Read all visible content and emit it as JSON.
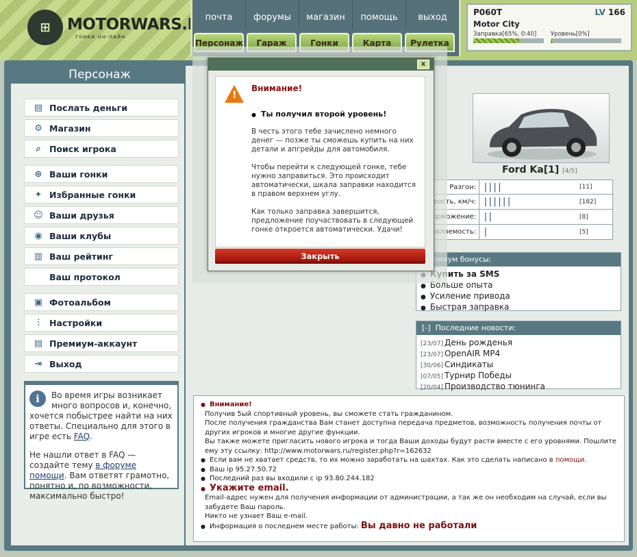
{
  "logo": {
    "name": "MOTORWARS.RU",
    "tagline": "гонки он-лайн"
  },
  "topnav": {
    "row1": [
      "почта",
      "форумы",
      "магазин",
      "помощь",
      "выход"
    ],
    "row2": [
      "Персонаж",
      "Гараж",
      "Гонки",
      "Карта",
      "Рулетка"
    ]
  },
  "status": {
    "nick": "P060T",
    "lv_label": "LV",
    "level": "166",
    "city": "Motor City",
    "fuel_label": "Заправка[65%, 0:40]",
    "fuel_pct": 65,
    "level_label": "Уровень[0%]",
    "level_pct": 0
  },
  "sidebar": {
    "title": "Персонаж",
    "group1": [
      "Послать деньги",
      "Магазин",
      "Поиск игрока"
    ],
    "group2": [
      "Ваши гонки",
      "Избранные гонки",
      "Ваши друзья",
      "Ваши клубы",
      "Ваш рейтинг",
      "Ваш протокол"
    ],
    "group3": [
      "Фотоальбом",
      "Настройки",
      "Премиум-аккаунт",
      "Выход"
    ],
    "faq_p1": "Во время игры возникает много вопросов и, конечно, хочется побыстрее найти на них ответы. Специально для этого в игре есть",
    "faq_link1": "FAQ",
    "faq_p2a": "Не нашли ответ в FAQ — создайте тему",
    "faq_link2": "в форуме помощи",
    "faq_p2b": ". Вам ответят грамотно, понятно и, по возможности, максимально быстро!"
  },
  "car": {
    "name": "Ford Ka[1]",
    "slots": "[4/5]",
    "stats": [
      {
        "label": "Разгон:",
        "bars": "||||",
        "value": "[11]"
      },
      {
        "label": "Скорость, км/ч:",
        "bars": "||||||",
        "value": "[182]"
      },
      {
        "label": "Торможение:",
        "bars": "||",
        "value": "[8]"
      },
      {
        "label": "Управляемость:",
        "bars": "|",
        "value": "[5]"
      }
    ]
  },
  "premium": {
    "header": "Премиум бонусы:",
    "items": [
      "Купить за SMS",
      "Больше опыта",
      "Усиление привода",
      "Быстрая заправка"
    ]
  },
  "news": {
    "toggle": "[-]",
    "header": "Последние новости:",
    "items": [
      {
        "date": "[23/07]",
        "title": "День рожденья"
      },
      {
        "date": "[23/07]",
        "title": "OpenAIR MP4"
      },
      {
        "date": "[30/06]",
        "title": "Синдикаты"
      },
      {
        "date": "[07/05]",
        "title": "Турнир Победы"
      },
      {
        "date": "[20/04]",
        "title": "Производство тюнинга"
      }
    ]
  },
  "info": {
    "warn_title": "Внимание!",
    "line1": "Получив 5ый спортивный уровень, вы сможете стать гражданином.",
    "line2": "После получения гражданства Вам станет доступна передача предметов, возможность получения почты от других игроков и многие другие функции.",
    "line3": "Вы также можете пригласить нового игрока и тогда Ваши доходы будут расти вместе с его уровнями. Пошлите ему эту ссылку: http://www.motorwars.ru/register.php?r=162632",
    "line4a": "Если вам не хватает средств, то их можно заработать на шахтах. Как это сделать написано в",
    "line4_link": "помощи",
    "line5": "Ваш ip 95.27.50.72",
    "line6": "Последний раз вы входили с ip 93.80.244.182",
    "email_title": "Укажите email.",
    "line7": "Email-адрес нужен для получения информации от администрации, а так же он необходим на случай, если вы забудете Ваш пароль.",
    "line8": "Никто не узнает Ваш e-mail.",
    "line9a": "Информация о последнем месте работы:",
    "line9b": "Вы давно не работали"
  },
  "modal": {
    "close_x": "x",
    "title": "Внимание!",
    "subtitle": "Ты получил второй уровень!",
    "p1": "В честь этого тебе зачислено немного денег — позже ты сможешь купить на них детали и апгрейды для автомобиля.",
    "p2": "Чтобы перейти к следующей гонке, тебе нужно заправиться. Это происходит автоматически, шкала заправки находится в правом верхнем углу.",
    "p3": "Как только заправка завершится, предложение поучаствовать в следующей гонке откроется автоматически. Удачи!",
    "button": "Закрыть"
  },
  "colors": {
    "accent": "#587982",
    "header_green": "#b8ce7e",
    "warning": "#7a1010",
    "button_red": "#b8241a"
  }
}
